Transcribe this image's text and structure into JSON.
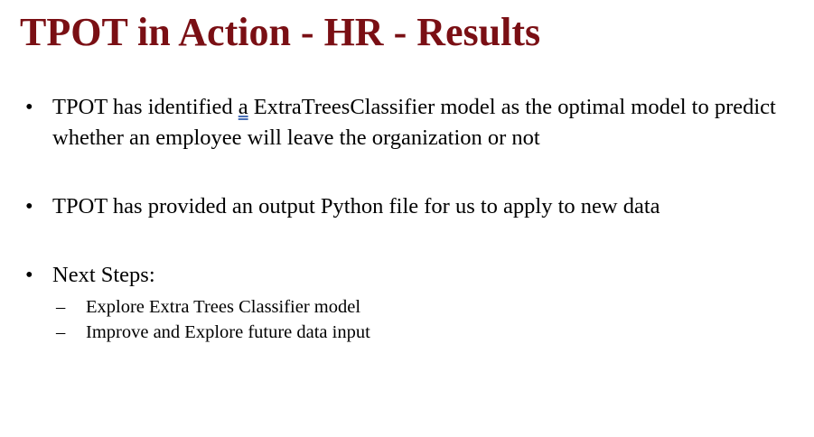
{
  "slide": {
    "title": "TPOT in Action - HR - Results",
    "title_color": "#7a0f14",
    "bullet_glyph": "•",
    "bullets": [
      {
        "before": "TPOT has identified ",
        "underlined": "a",
        "after": " ExtraTreesClassifier model as the optimal model to predict whether an employee will leave the organization or not"
      },
      {
        "text": "TPOT has provided an output Python file for us to apply to new data"
      },
      {
        "text": "Next Steps:",
        "sub_glyph": "–",
        "sub_items": [
          "Explore Extra Trees Classifier model",
          "Improve and Explore future data input"
        ]
      }
    ]
  }
}
